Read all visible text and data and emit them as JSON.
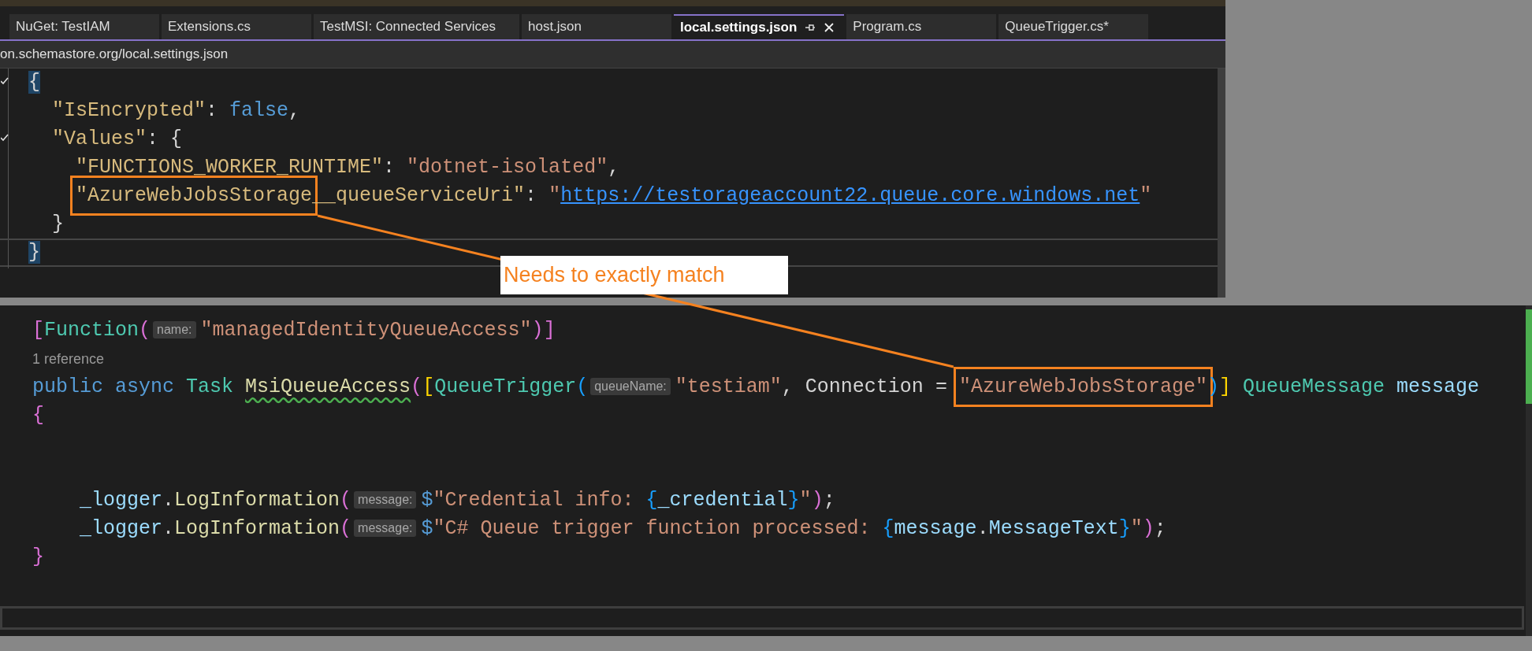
{
  "tabs": [
    {
      "label": "NuGet: TestIAM",
      "selected": false
    },
    {
      "label": "Extensions.cs",
      "selected": false
    },
    {
      "label": "TestMSI: Connected Services",
      "selected": false
    },
    {
      "label": "host.json",
      "selected": false
    },
    {
      "label": "local.settings.json",
      "selected": true
    },
    {
      "label": "Program.cs",
      "selected": false
    },
    {
      "label": "QueueTrigger.cs*",
      "selected": false
    }
  ],
  "path_bar": {
    "text": "on.schemastore.org/local.settings.json"
  },
  "top_editor": {
    "lines": [
      {
        "kind": "code",
        "foldable": true,
        "current": false,
        "tokens": [
          {
            "text": "{",
            "kind": "plain",
            "matched": true
          }
        ],
        "children": [
          {
            "kind": "code",
            "foldable": false,
            "current": false,
            "tokens": [
              {
                "text": "\"IsEncrypted\"",
                "kind": "key"
              },
              {
                "text": ": ",
                "kind": "plain"
              },
              {
                "text": "false",
                "kind": "keyword"
              },
              {
                "text": ",",
                "kind": "plain"
              }
            ]
          },
          {
            "kind": "code",
            "foldable": true,
            "current": false,
            "tokens": [
              {
                "text": "\"Values\"",
                "kind": "key"
              },
              {
                "text": ": {",
                "kind": "plain"
              }
            ],
            "children": [
              {
                "kind": "code",
                "foldable": false,
                "current": false,
                "tokens": [
                  {
                    "text": "\"FUNCTIONS_WORKER_RUNTIME\"",
                    "kind": "key"
                  },
                  {
                    "text": ": ",
                    "kind": "plain"
                  },
                  {
                    "text": "\"dotnet-isolated\"",
                    "kind": "string"
                  },
                  {
                    "text": ",",
                    "kind": "plain"
                  }
                ]
              },
              {
                "kind": "code",
                "foldable": false,
                "current": false,
                "tokens": [
                  {
                    "text": "\"AzureWebJobsStorage",
                    "kind": "key",
                    "boxed": true
                  },
                  {
                    "text": "__queueServiceUri\"",
                    "kind": "key"
                  },
                  {
                    "text": ": ",
                    "kind": "plain"
                  },
                  {
                    "text": "\"",
                    "kind": "string"
                  },
                  {
                    "text": "https://testorageaccount22.queue.core.windows.net",
                    "kind": "link"
                  },
                  {
                    "text": "\"",
                    "kind": "string"
                  }
                ]
              }
            ]
          },
          {
            "kind": "code",
            "foldable": false,
            "current": false,
            "tokens": [
              {
                "text": "}",
                "kind": "plain"
              }
            ]
          }
        ]
      },
      {
        "kind": "code",
        "foldable": false,
        "current": true,
        "tokens": [
          {
            "text": "}",
            "kind": "plain",
            "matched": true
          }
        ]
      }
    ]
  },
  "bottom_editor": {
    "lines": [
      {
        "kind": "code",
        "tokens": [
          {
            "text": "[",
            "kind": "bracket1"
          },
          {
            "text": "Function",
            "kind": "type"
          },
          {
            "text": "(",
            "kind": "bracket1"
          },
          {
            "text": "name:",
            "kind": "hint"
          },
          {
            "text": "\"managedIdentityQueueAccess\"",
            "kind": "string"
          },
          {
            "text": ")",
            "kind": "bracket1"
          },
          {
            "text": "]",
            "kind": "bracket1"
          }
        ]
      },
      {
        "kind": "lens",
        "text": "1 reference"
      },
      {
        "kind": "code",
        "tokens": [
          {
            "text": "public async ",
            "kind": "keyword"
          },
          {
            "text": "Task ",
            "kind": "type"
          },
          {
            "text": "MsiQueueAccess",
            "kind": "method",
            "warning": true
          },
          {
            "text": "(",
            "kind": "bracket1"
          },
          {
            "text": "[",
            "kind": "bracket2"
          },
          {
            "text": "QueueTrigger",
            "kind": "type"
          },
          {
            "text": "(",
            "kind": "bracket3"
          },
          {
            "text": "queueName:",
            "kind": "hint"
          },
          {
            "text": "\"testiam\"",
            "kind": "string"
          },
          {
            "text": ", Connection = ",
            "kind": "plain"
          },
          {
            "text": "\"AzureWebJobsStorage\"",
            "kind": "string",
            "boxed": true
          },
          {
            "text": ")",
            "kind": "bracket3"
          },
          {
            "text": "]",
            "kind": "bracket2"
          },
          {
            "text": " QueueMessage",
            "kind": "type"
          },
          {
            "text": " message",
            "kind": "variable"
          }
        ]
      },
      {
        "kind": "code",
        "tokens": [
          {
            "text": "{",
            "kind": "bracket1"
          }
        ],
        "children": [
          {
            "kind": "blank"
          },
          {
            "kind": "blank"
          },
          {
            "kind": "code",
            "tokens": [
              {
                "text": "_logger",
                "kind": "variable"
              },
              {
                "text": ".",
                "kind": "plain"
              },
              {
                "text": "LogInformation",
                "kind": "method"
              },
              {
                "text": "(",
                "kind": "bracket1"
              },
              {
                "text": "message:",
                "kind": "hint"
              },
              {
                "text": "$",
                "kind": "keyword"
              },
              {
                "text": "\"Credential info: ",
                "kind": "string"
              },
              {
                "text": "{",
                "kind": "bracket3"
              },
              {
                "text": "_credential",
                "kind": "variable"
              },
              {
                "text": "}",
                "kind": "bracket3"
              },
              {
                "text": "\"",
                "kind": "string"
              },
              {
                "text": ")",
                "kind": "bracket1"
              },
              {
                "text": ";",
                "kind": "plain"
              }
            ]
          },
          {
            "kind": "code",
            "tokens": [
              {
                "text": "_logger",
                "kind": "variable"
              },
              {
                "text": ".",
                "kind": "plain"
              },
              {
                "text": "LogInformation",
                "kind": "method"
              },
              {
                "text": "(",
                "kind": "bracket1"
              },
              {
                "text": "message:",
                "kind": "hint"
              },
              {
                "text": "$",
                "kind": "keyword"
              },
              {
                "text": "\"C# Queue trigger function processed: ",
                "kind": "string"
              },
              {
                "text": "{",
                "kind": "bracket3"
              },
              {
                "text": "message",
                "kind": "variable"
              },
              {
                "text": ".",
                "kind": "plain"
              },
              {
                "text": "MessageText",
                "kind": "variable"
              },
              {
                "text": "}",
                "kind": "bracket3"
              },
              {
                "text": "\"",
                "kind": "string"
              },
              {
                "text": ")",
                "kind": "bracket1"
              },
              {
                "text": ";",
                "kind": "plain"
              }
            ]
          }
        ]
      },
      {
        "kind": "code",
        "tokens": [
          {
            "text": "}",
            "kind": "bracket1"
          }
        ]
      }
    ]
  },
  "annotation": {
    "label": "Needs to exactly match"
  }
}
